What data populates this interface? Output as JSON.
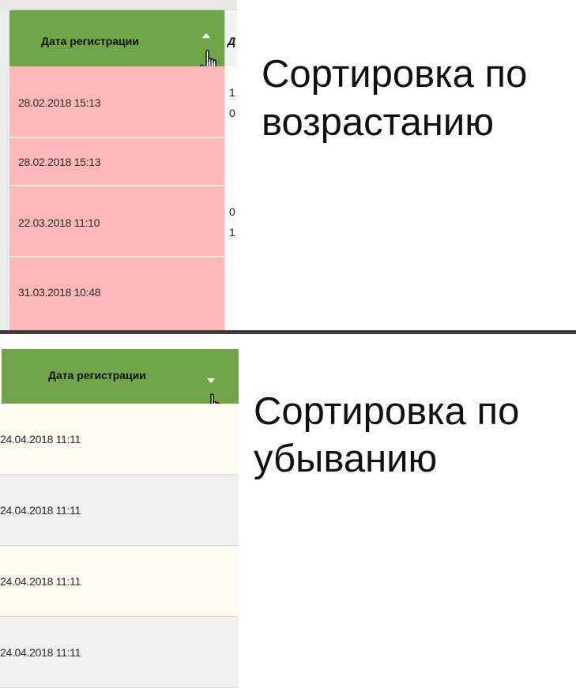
{
  "colors": {
    "header_green": "#70a54a",
    "highlight_pink": "#ffb9b9",
    "row_cream": "#fcfcf2",
    "row_gray": "#efefef",
    "separator": "#3c3c3c"
  },
  "icons": {
    "sort_ascending": "sort-up-arrow",
    "sort_descending": "sort-down-arrow",
    "cursor": "hand-pointer"
  },
  "ascending": {
    "column_header": "Дата регистрации",
    "next_column_header_fragment": "Д",
    "rows": [
      {
        "date": "28.02.2018 15:13",
        "next_line1": "1",
        "next_line2": "0"
      },
      {
        "date": "28.02.2018 15:13",
        "next_line1": "",
        "next_line2": ""
      },
      {
        "date": "22.03.2018 11:10",
        "next_line1": "0",
        "next_line2": "1"
      },
      {
        "date": "31.03.2018 10:48",
        "next_line1": "",
        "next_line2": ""
      }
    ],
    "caption_line1": "Сортировка по",
    "caption_line2": "возрастанию"
  },
  "descending": {
    "column_header": "Дата регистрации",
    "rows": [
      {
        "date": "24.04.2018 11:11"
      },
      {
        "date": "24.04.2018 11:11"
      },
      {
        "date": "24.04.2018 11:11"
      },
      {
        "date": "24.04.2018 11:11"
      }
    ],
    "caption_line1": "Сортировка по",
    "caption_line2": "убыванию"
  }
}
